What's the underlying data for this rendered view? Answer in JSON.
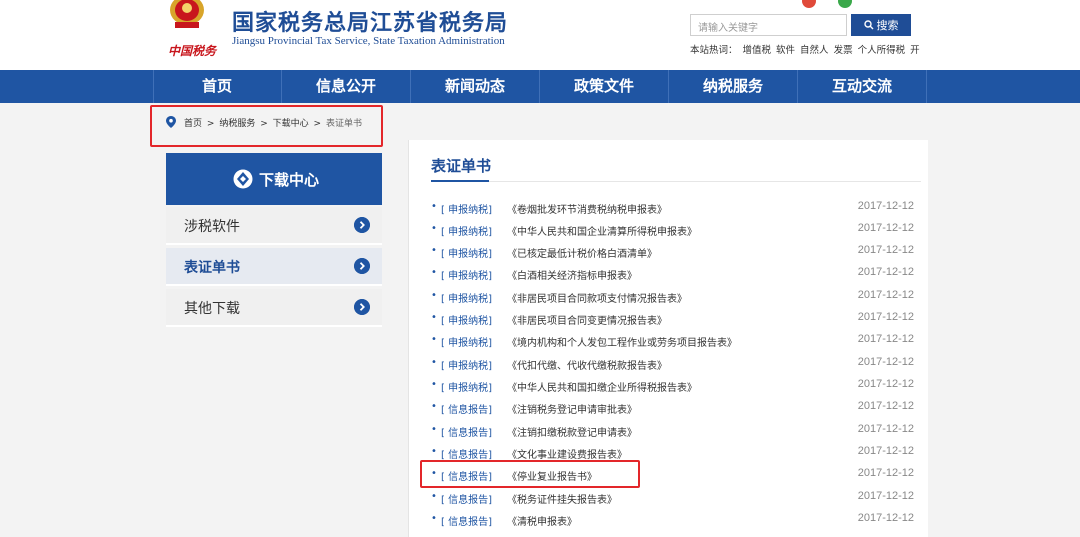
{
  "header": {
    "title_cn": "国家税务总局江苏省税务局",
    "title_en": "Jiangsu Provincial Tax Service, State Taxation Administration",
    "signature": "中国税务",
    "search_placeholder": "请输入关键字",
    "search_button": "搜索",
    "hot_words": [
      "本站热词：",
      "增值税",
      "软件",
      "自然人",
      "发票",
      "个人所得税",
      "开"
    ]
  },
  "nav": {
    "items": [
      "首页",
      "信息公开",
      "新闻动态",
      "政策文件",
      "纳税服务",
      "互动交流"
    ]
  },
  "breadcrumb": {
    "items": [
      "首页",
      ">",
      "纳税服务",
      ">",
      "下载中心",
      ">",
      "表证单书"
    ]
  },
  "sidebar": {
    "title": "下载中心",
    "items": [
      {
        "label": "涉税软件",
        "active": false
      },
      {
        "label": "表证单书",
        "active": true
      },
      {
        "label": "其他下载",
        "active": false
      }
    ]
  },
  "main": {
    "title": "表证单书",
    "rows": [
      {
        "cat": "[ 申报纳税]",
        "title": "《卷烟批发环节消费税纳税申报表》",
        "date": "2017-12-12"
      },
      {
        "cat": "[ 申报纳税]",
        "title": "《中华人民共和国企业清算所得税申报表》",
        "date": "2017-12-12"
      },
      {
        "cat": "[ 申报纳税]",
        "title": "《已核定最低计税价格白酒清单》",
        "date": "2017-12-12"
      },
      {
        "cat": "[ 申报纳税]",
        "title": "《白酒相关经济指标申报表》",
        "date": "2017-12-12"
      },
      {
        "cat": "[ 申报纳税]",
        "title": "《非居民项目合同款项支付情况报告表》",
        "date": "2017-12-12"
      },
      {
        "cat": "[ 申报纳税]",
        "title": "《非居民项目合同变更情况报告表》",
        "date": "2017-12-12"
      },
      {
        "cat": "[ 申报纳税]",
        "title": "《境内机构和个人发包工程作业或劳务项目报告表》",
        "date": "2017-12-12"
      },
      {
        "cat": "[ 申报纳税]",
        "title": "《代扣代缴、代收代缴税款报告表》",
        "date": "2017-12-12"
      },
      {
        "cat": "[ 申报纳税]",
        "title": "《中华人民共和国扣缴企业所得税报告表》",
        "date": "2017-12-12"
      },
      {
        "cat": "[ 信息报告]",
        "title": "《注销税务登记申请审批表》",
        "date": "2017-12-12"
      },
      {
        "cat": "[ 信息报告]",
        "title": "《注销扣缴税款登记申请表》",
        "date": "2017-12-12"
      },
      {
        "cat": "[ 信息报告]",
        "title": "《文化事业建设费报告表》",
        "date": "2017-12-12"
      },
      {
        "cat": "[ 信息报告]",
        "title": "《停业复业报告书》",
        "date": "2017-12-12"
      },
      {
        "cat": "[ 信息报告]",
        "title": "《税务证件挂失报告表》",
        "date": "2017-12-12"
      },
      {
        "cat": "[ 信息报告]",
        "title": "《清税申报表》",
        "date": "2017-12-12"
      }
    ]
  },
  "colors": {
    "brand_blue": "#1f55a3",
    "highlight_red": "#e3262a"
  }
}
